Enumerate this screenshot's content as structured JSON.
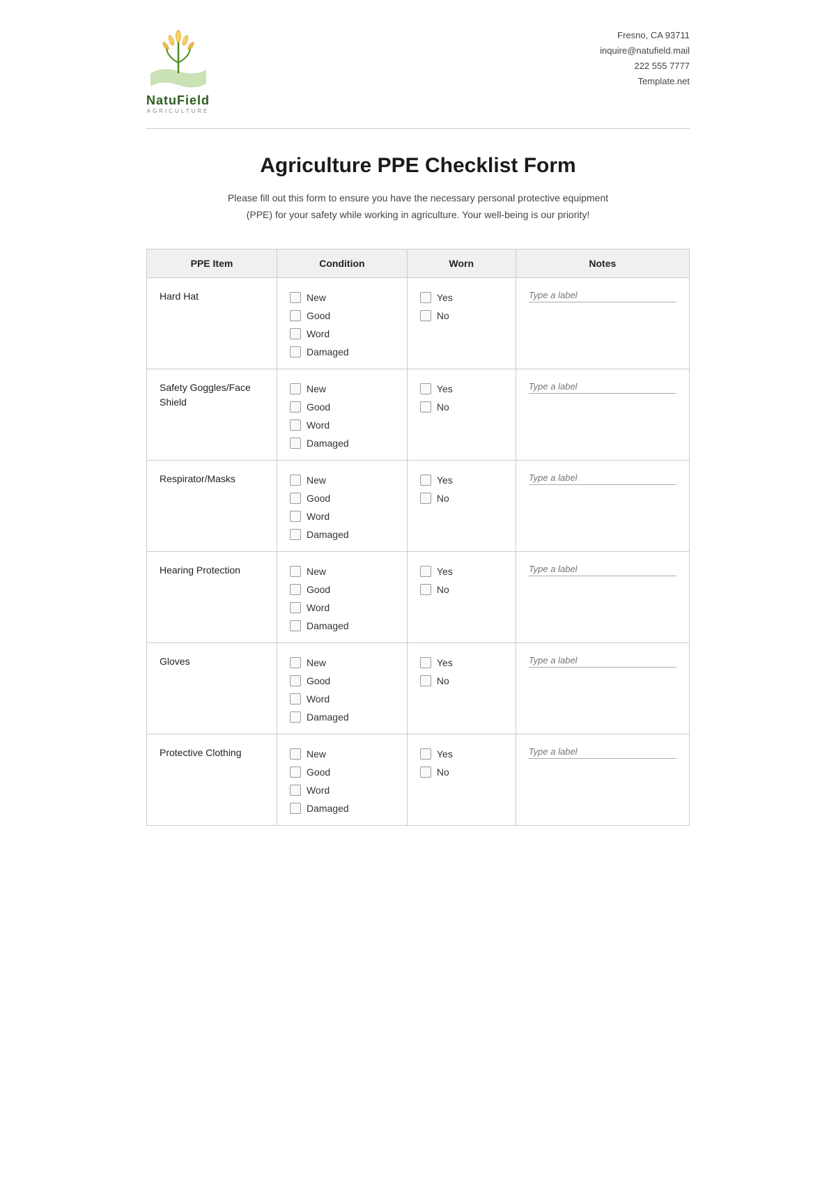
{
  "header": {
    "logo_name": "NatuField",
    "logo_sub": "Agriculture",
    "contact": {
      "address": "Fresno, CA 93711",
      "email": "inquire@natufield.mail",
      "phone": "222 555 7777",
      "website": "Template.net"
    }
  },
  "form": {
    "title": "Agriculture PPE Checklist Form",
    "description_line1": "Please fill out this form to ensure you have the necessary personal protective equipment",
    "description_line2": "(PPE) for your safety while working in agriculture. Your well-being is our priority!"
  },
  "table": {
    "headers": [
      "PPE Item",
      "Condition",
      "Worn",
      "Notes"
    ],
    "condition_options": [
      "New",
      "Good",
      "Word",
      "Damaged"
    ],
    "worn_options": [
      "Yes",
      "No"
    ],
    "notes_placeholder": "Type a label",
    "rows": [
      {
        "item": "Hard Hat"
      },
      {
        "item": "Safety Goggles/Face Shield"
      },
      {
        "item": "Respirator/Masks"
      },
      {
        "item": "Hearing Protection"
      },
      {
        "item": "Gloves"
      },
      {
        "item": "Protective Clothing"
      }
    ]
  }
}
